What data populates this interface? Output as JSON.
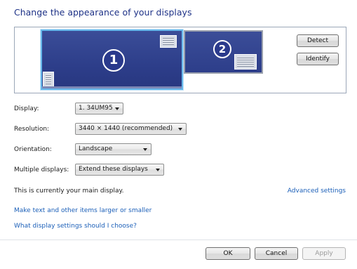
{
  "title": "Change the appearance of your displays",
  "monitors": [
    {
      "number": "1",
      "selected": true
    },
    {
      "number": "2",
      "selected": false
    }
  ],
  "buttons": {
    "detect": "Detect",
    "identify": "Identify",
    "ok": "OK",
    "cancel": "Cancel",
    "apply": "Apply"
  },
  "settings": {
    "display_label": "Display:",
    "display_value": "1. 34UM95",
    "resolution_label": "Resolution:",
    "resolution_value": "3440 × 1440 (recommended)",
    "orientation_label": "Orientation:",
    "orientation_value": "Landscape",
    "multiple_label": "Multiple displays:",
    "multiple_value": "Extend these displays"
  },
  "main_display_text": "This is currently your main display.",
  "links": {
    "advanced": "Advanced settings",
    "text_size": "Make text and other items larger or smaller",
    "help": "What display settings should I choose?"
  },
  "colors": {
    "title": "#1e3287",
    "link": "#1b5fb8",
    "selection_border": "#66b7ea",
    "monitor_fill": "#2d3e8a"
  }
}
